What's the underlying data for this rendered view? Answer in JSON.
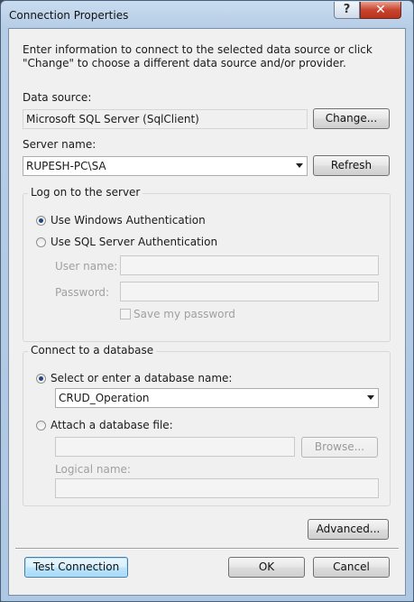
{
  "window": {
    "title": "Connection Properties",
    "help_label": "?",
    "close_label": "✕"
  },
  "intro": "Enter information to connect to the selected data source or click \"Change\" to choose a different data source and/or provider.",
  "data_source": {
    "label": "Data source:",
    "value": "Microsoft SQL Server (SqlClient)",
    "change_label": "Change..."
  },
  "server": {
    "label": "Server name:",
    "value": "RUPESH-PC\\SA",
    "refresh_label": "Refresh"
  },
  "logon": {
    "group_title": "Log on to the server",
    "windows_auth_label": "Use Windows Authentication",
    "sql_auth_label": "Use SQL Server Authentication",
    "selected": "windows",
    "username_label": "User name:",
    "username_value": "",
    "password_label": "Password:",
    "password_value": "",
    "save_password_label": "Save my password",
    "save_password_checked": false
  },
  "database": {
    "group_title": "Connect to a database",
    "select_label": "Select or enter a database name:",
    "select_value": "CRUD_Operation",
    "attach_label": "Attach a database file:",
    "attach_value": "",
    "browse_label": "Browse...",
    "logical_label": "Logical name:",
    "logical_value": "",
    "selected": "select"
  },
  "buttons": {
    "advanced_label": "Advanced...",
    "test_label": "Test Connection",
    "ok_label": "OK",
    "cancel_label": "Cancel"
  }
}
